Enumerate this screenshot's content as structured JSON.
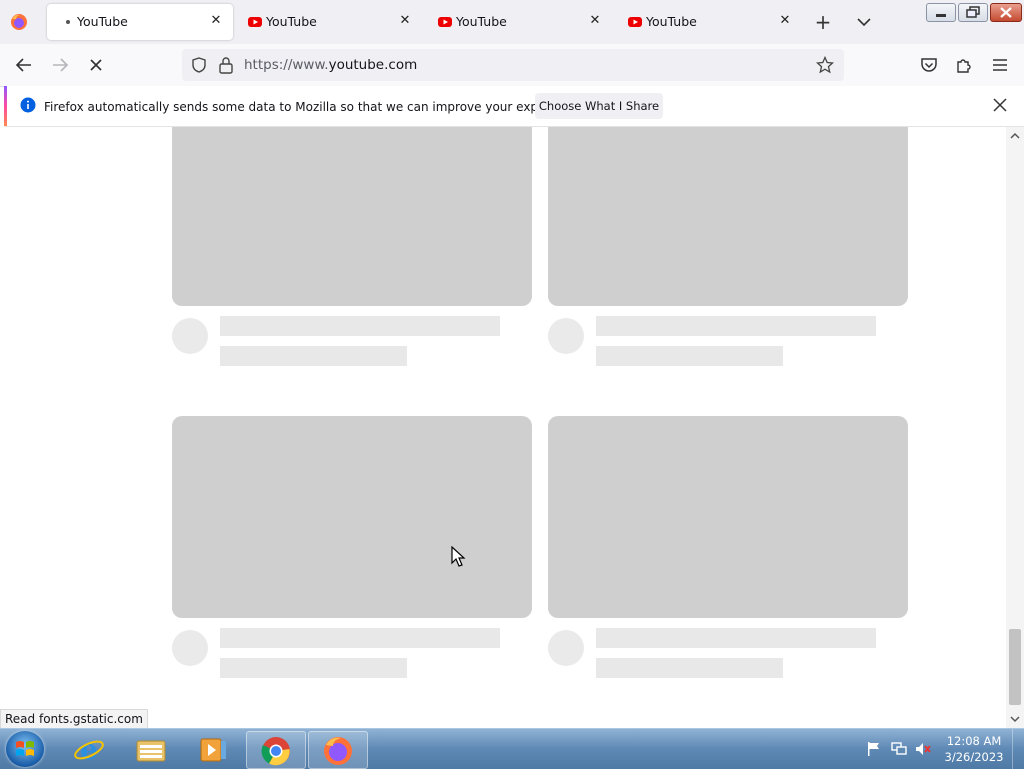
{
  "browser": {
    "tabs": [
      {
        "title": "YouTube",
        "state": "loading",
        "active": true
      },
      {
        "title": "YouTube",
        "state": "loaded",
        "active": false
      },
      {
        "title": "YouTube",
        "state": "loaded",
        "active": false
      },
      {
        "title": "YouTube",
        "state": "loaded",
        "active": false
      }
    ],
    "url_prefix": "https://www.",
    "url_domain": "youtube.com",
    "status_text": "Read fonts.gstatic.com"
  },
  "notification": {
    "message": "Firefox automatically sends some data to Mozilla so that we can improve your experience.",
    "button_label": "Choose What I Share"
  },
  "taskbar": {
    "clock_time": "12:08 AM",
    "clock_date": "3/26/2023",
    "apps": [
      "internet-explorer",
      "file-explorer",
      "media-player",
      "chrome",
      "firefox"
    ]
  },
  "colors": {
    "youtube_red": "#ff0000",
    "skeleton_thumb": "#cfcfcf",
    "skeleton_line": "#e8e8e8"
  }
}
